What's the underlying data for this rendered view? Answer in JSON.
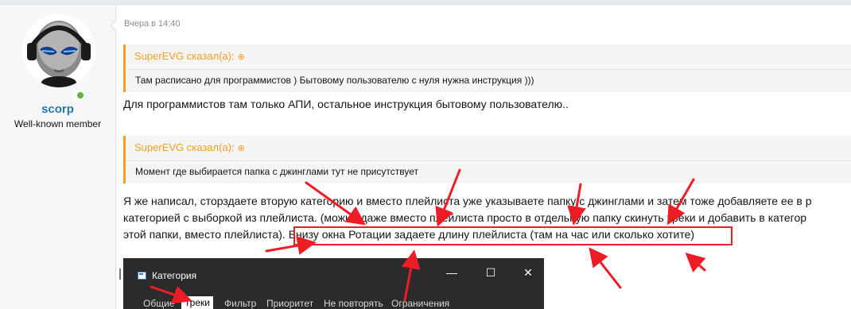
{
  "user": {
    "name": "scorp",
    "title": "Well-known member",
    "avatar_icon": "alien-headphones-avatar",
    "online_color": "#63b13e"
  },
  "post": {
    "date": "Вчера в 14:40",
    "quote1": {
      "author": "SuperEVG сказал(а):",
      "text": "Там расписано для программистов ) Бытовому пользователю с нуля нужна инструкция )))"
    },
    "message1": "Для программистов там только АПИ, остальное инструкция бытовому пользователю..",
    "quote2": {
      "author": "SuperEVG сказал(а):",
      "text": "Момент где выбирается папка с джинглами тут не присутствует"
    },
    "paragraph": {
      "line1": "Я же написал, сторздаете вторую категорию и вместо плейлиста уже указываете папку с джинглами и затем тоже добавляете ее в р",
      "line2": "категорией с выборкой из плейлиста. (можно даже вместо плейлиста просто в отдельную папку скинуть треки и добавить в категор",
      "line3_start": "этой папки, вместо плейлиста).",
      "line3_highlight": "Внизу окна Ротации задаете длину плейлиста (там на час или сколько хотите)"
    }
  },
  "dialog": {
    "title": "Категория",
    "tabs": [
      "Общие",
      "Треки",
      "Фильтр",
      "Приоритет",
      "Не повторять",
      "Ограничения"
    ],
    "active_tab": "Треки",
    "minimize_glyph": "—",
    "maximize_glyph": "☐",
    "close_glyph": "✕"
  },
  "colors": {
    "accent": "#f59d25",
    "link": "#2577b1",
    "annotation": "#ee1c25"
  }
}
